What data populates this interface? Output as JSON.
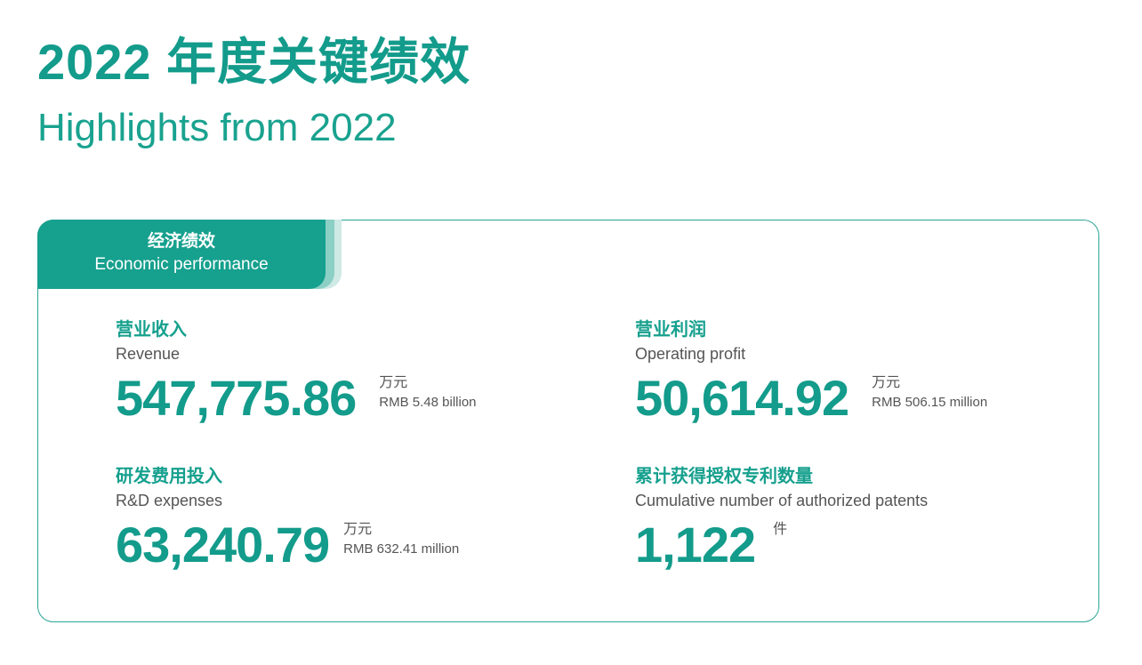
{
  "title": {
    "cn": "2022 年度关键绩效",
    "en": "Highlights from 2022"
  },
  "section": {
    "tab_cn": "经济绩效",
    "tab_en": "Economic performance"
  },
  "metrics": {
    "revenue": {
      "label_cn": "营业收入",
      "label_en": "Revenue",
      "value": "547,775.86",
      "unit_cn": "万元",
      "unit_en": "RMB 5.48 billion"
    },
    "operating_profit": {
      "label_cn": "营业利润",
      "label_en": "Operating profit",
      "value": "50,614.92",
      "unit_cn": "万元",
      "unit_en": "RMB 506.15 million"
    },
    "rd_expenses": {
      "label_cn": "研发费用投入",
      "label_en": "R&D expenses",
      "value": "63,240.79",
      "unit_cn": "万元",
      "unit_en": "RMB 632.41 million"
    },
    "patents": {
      "label_cn": "累计获得授权专利数量",
      "label_en": "Cumulative number of authorized patents",
      "value": "1,122",
      "unit_cn": "件"
    }
  },
  "colors": {
    "accent": "#139b8b",
    "tab": "#16a08e",
    "text_secondary": "#555555"
  }
}
